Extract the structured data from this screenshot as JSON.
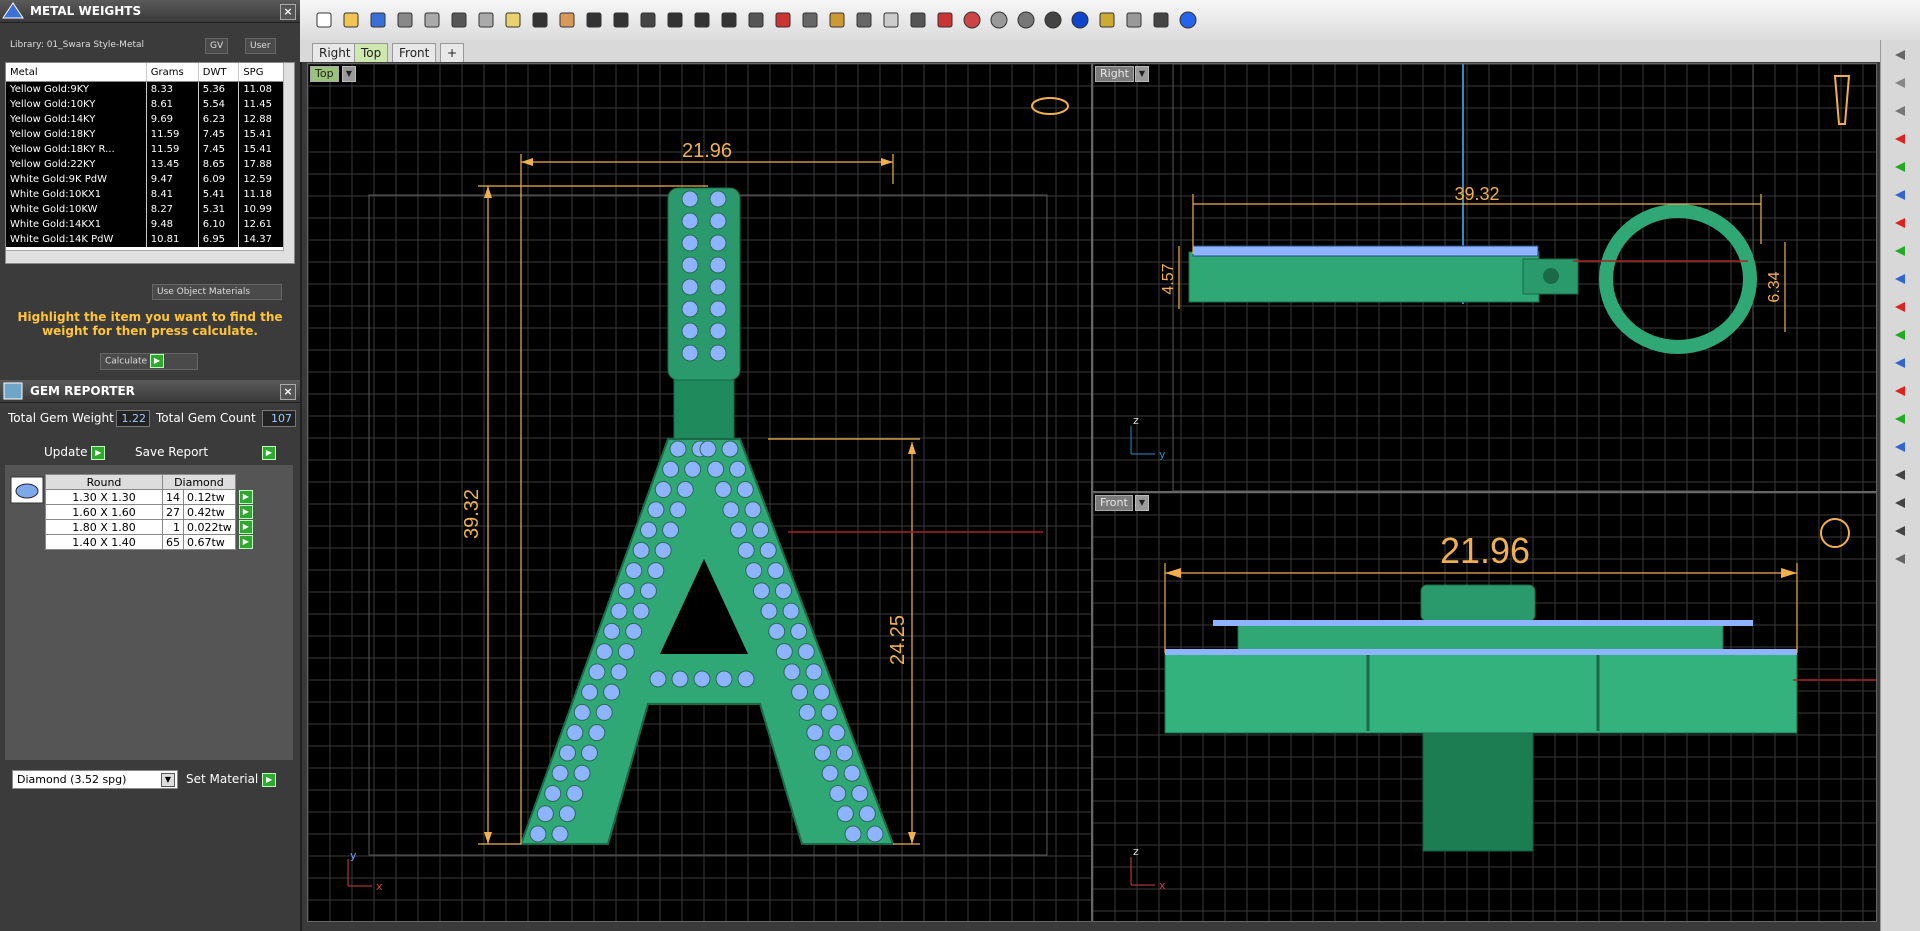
{
  "metal_weights": {
    "title": "METAL WEIGHTS",
    "library": "Library: 01_Swara Style-Metal",
    "gv_label": "GV",
    "user_label": "User",
    "columns": [
      "Metal",
      "Grams",
      "DWT",
      "SPG"
    ],
    "rows": [
      [
        "Yellow Gold:9KY",
        "8.33",
        "5.36",
        "11.08"
      ],
      [
        "Yellow Gold:10KY",
        "8.61",
        "5.54",
        "11.45"
      ],
      [
        "Yellow Gold:14KY",
        "9.69",
        "6.23",
        "12.88"
      ],
      [
        "Yellow Gold:18KY",
        "11.59",
        "7.45",
        "15.41"
      ],
      [
        "Yellow Gold:18KY R...",
        "11.59",
        "7.45",
        "15.41"
      ],
      [
        "Yellow Gold:22KY",
        "13.45",
        "8.65",
        "17.88"
      ],
      [
        "White Gold:9K PdW",
        "9.47",
        "6.09",
        "12.59"
      ],
      [
        "White Gold:10KX1",
        "8.41",
        "5.41",
        "11.18"
      ],
      [
        "White Gold:10KW",
        "8.27",
        "5.31",
        "10.99"
      ],
      [
        "White Gold:14KX1",
        "9.48",
        "6.10",
        "12.61"
      ],
      [
        "White Gold:14K PdW",
        "10.81",
        "6.95",
        "14.37"
      ]
    ],
    "use_object_materials": "Use Object Materials",
    "hint": "Highlight the item you want to find the weight for then press calculate.",
    "calculate": "Calculate"
  },
  "gem_reporter": {
    "title": "GEM REPORTER",
    "total_weight_label": "Total Gem Weight",
    "total_weight": "1.22",
    "total_count_label": "Total Gem Count",
    "total_count": "107",
    "update": "Update",
    "save_report": "Save Report",
    "header_shape": "Round",
    "header_material": "Diamond",
    "rows": [
      [
        "1.30 X 1.30",
        "14",
        "0.12tw"
      ],
      [
        "1.60 X 1.60",
        "27",
        "0.42tw"
      ],
      [
        "1.80 X 1.80",
        "1",
        "0.022tw"
      ],
      [
        "1.40 X 1.40",
        "65",
        "0.67tw"
      ]
    ],
    "material_select": "Diamond    (3.52 spg)",
    "set_material": "Set Material"
  },
  "tabs": [
    "Right",
    "Top",
    "Front",
    "+"
  ],
  "viewports": {
    "top": {
      "label": "Top",
      "dim_width": "21.96",
      "dim_height": "39.32",
      "dim_inner": "24.25",
      "axis_y": "y",
      "axis_x": "x"
    },
    "right": {
      "label": "Right",
      "dim_length": "39.32",
      "dim_left": "4.57",
      "dim_right": "6.34",
      "axis_z": "z",
      "axis_y": "y"
    },
    "front": {
      "label": "Front",
      "dim_width": "21.96",
      "axis_z": "z",
      "axis_x": "x"
    }
  },
  "colors": {
    "metal": "#2fa876",
    "gem": "#8fb4ff",
    "dim": "#f0b050",
    "grid": "#3c3c3c"
  }
}
